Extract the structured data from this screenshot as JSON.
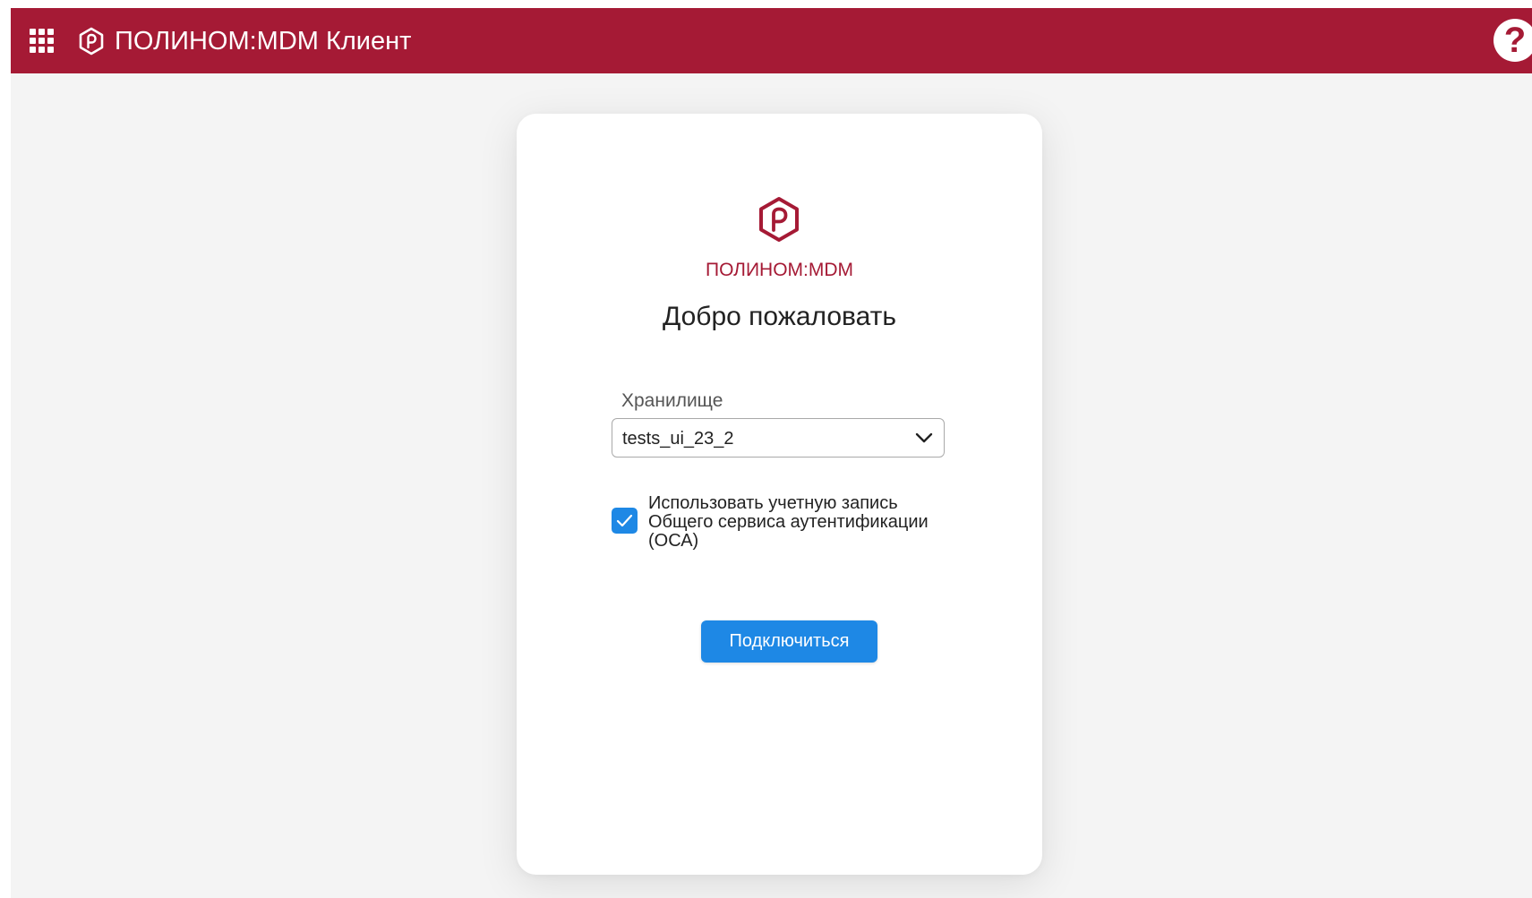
{
  "colors": {
    "brand": "#a51a35",
    "accent": "#1e88e5",
    "background": "#f4f4f4",
    "card": "#ffffff"
  },
  "header": {
    "apps_icon": "apps-grid-icon",
    "logo_icon": "polinom-logo-icon",
    "title": "ПОЛИНОМ:MDM Клиент",
    "help_icon": "help-icon",
    "help_label": "?"
  },
  "login": {
    "logo_icon": "polinom-logo-icon",
    "brand": "ПОЛИНОМ:MDM",
    "welcome": "Добро пожаловать",
    "storage": {
      "label": "Хранилище",
      "value": "tests_ui_23_2",
      "chevron_icon": "chevron-down-icon"
    },
    "oca_checkbox": {
      "checked": true,
      "label": "Использовать учетную запись Общего сервиса аутентификации (ОСА)"
    },
    "connect_label": "Подключиться"
  }
}
